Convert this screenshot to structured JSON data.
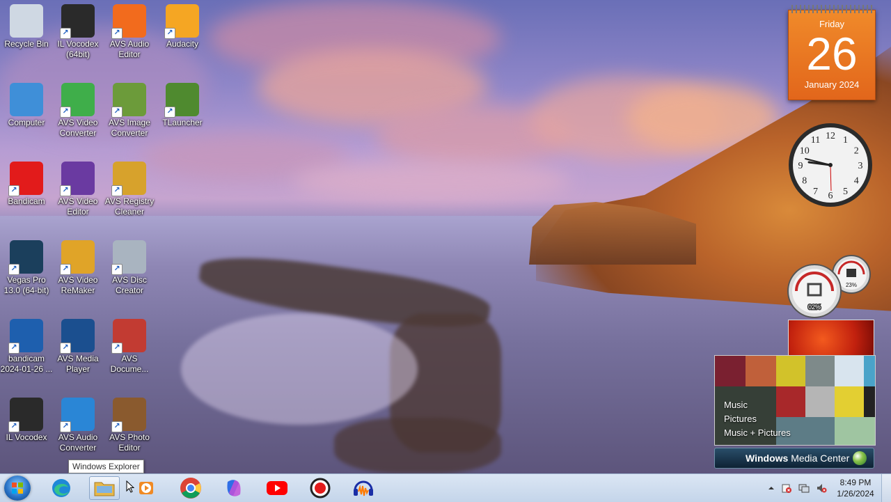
{
  "desktop": {
    "icons": [
      {
        "label": "Recycle Bin",
        "icon": "recycle-bin-icon",
        "color": "#cfd8e3"
      },
      {
        "label": "IL Vocodex (64bit)",
        "icon": "il-vocodex-icon",
        "color": "#2a2a2a"
      },
      {
        "label": "AVS Audio Editor",
        "icon": "avs-audio-editor-icon",
        "color": "#f26b1d"
      },
      {
        "label": "Audacity",
        "icon": "audacity-icon",
        "color": "#f5a623"
      },
      {
        "label": "Computer",
        "icon": "computer-icon",
        "color": "#3f8fd8"
      },
      {
        "label": "AVS Video Converter",
        "icon": "avs-video-converter-icon",
        "color": "#3fae4a"
      },
      {
        "label": "AVS Image Converter",
        "icon": "avs-image-converter-icon",
        "color": "#6c9b3a"
      },
      {
        "label": "TLauncher",
        "icon": "tlauncher-icon",
        "color": "#4f8a2f"
      },
      {
        "label": "Bandicam",
        "icon": "bandicam-icon",
        "color": "#e21b1b"
      },
      {
        "label": "AVS Video Editor",
        "icon": "avs-video-editor-icon",
        "color": "#6a3aa1"
      },
      {
        "label": "AVS Registry Cleaner",
        "icon": "avs-registry-cleaner-icon",
        "color": "#d7a22c"
      },
      {
        "label": "Vegas Pro 13.0 (64-bit)",
        "icon": "vegas-pro-icon",
        "color": "#1b3f5c"
      },
      {
        "label": "AVS Video ReMaker",
        "icon": "avs-video-remaker-icon",
        "color": "#e0a428"
      },
      {
        "label": "AVS Disc Creator",
        "icon": "avs-disc-creator-icon",
        "color": "#a9b4c0"
      },
      {
        "label": "bandicam 2024-01-26 ...",
        "icon": "video-file-icon",
        "color": "#1e5fae"
      },
      {
        "label": "AVS Media Player",
        "icon": "avs-media-player-icon",
        "color": "#1b4f8f"
      },
      {
        "label": "AVS Docume...",
        "icon": "avs-document-converter-icon",
        "color": "#c23b32"
      },
      {
        "label": "IL Vocodex",
        "icon": "il-vocodex-icon",
        "color": "#2a2a2a"
      },
      {
        "label": "AVS Audio Converter",
        "icon": "avs-audio-converter-icon",
        "color": "#2a86d6"
      },
      {
        "label": "AVS Photo Editor",
        "icon": "avs-photo-editor-icon",
        "color": "#8a5a2e"
      }
    ]
  },
  "gadgets": {
    "calendar": {
      "day_name": "Friday",
      "day_number": "26",
      "month_year": "January 2024"
    },
    "clock": {
      "numbers": [
        "12",
        "1",
        "2",
        "3",
        "4",
        "5",
        "6",
        "7",
        "8",
        "9",
        "10",
        "11"
      ]
    },
    "meters": {
      "cpu": "02%",
      "memory": "23%"
    },
    "media_center": {
      "menu": [
        "Music",
        "Pictures",
        "Music + Pictures"
      ],
      "bar_title_bold": "Windows",
      "bar_title_rest": " Media Center"
    }
  },
  "tooltip": "Windows Explorer",
  "taskbar": {
    "pinned": [
      {
        "name": "edge",
        "icon": "edge-icon"
      },
      {
        "name": "windows-explorer",
        "icon": "folder-icon"
      },
      {
        "name": "media-player",
        "icon": "media-player-icon"
      },
      {
        "name": "chrome",
        "icon": "chrome-icon"
      },
      {
        "name": "copilot",
        "icon": "copilot-icon"
      },
      {
        "name": "youtube",
        "icon": "youtube-icon"
      },
      {
        "name": "bandicam",
        "icon": "bandicam-icon"
      },
      {
        "name": "audacity",
        "icon": "audacity-icon"
      }
    ],
    "time": "8:49 PM",
    "date": "1/26/2024"
  },
  "colors": {
    "calendar_orange": "#e8701f",
    "taskbar": "#d2deef",
    "youtube_red": "#ff0000"
  }
}
